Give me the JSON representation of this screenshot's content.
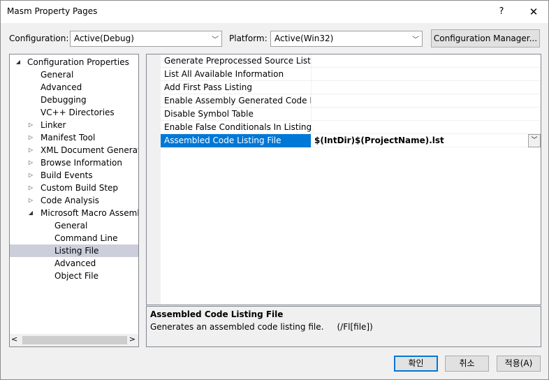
{
  "window": {
    "title": "Masm Property Pages",
    "help": "?",
    "close": "✕"
  },
  "toolbar": {
    "configuration_label": "Configuration:",
    "configuration_value": "Active(Debug)",
    "platform_label": "Platform:",
    "platform_value": "Active(Win32)",
    "config_manager_label": "Configuration Manager..."
  },
  "tree": {
    "items": [
      {
        "label": "Configuration Properties",
        "level": 0,
        "expander": "◢"
      },
      {
        "label": "General",
        "level": 1,
        "expander": ""
      },
      {
        "label": "Advanced",
        "level": 1,
        "expander": ""
      },
      {
        "label": "Debugging",
        "level": 1,
        "expander": ""
      },
      {
        "label": "VC++ Directories",
        "level": 1,
        "expander": ""
      },
      {
        "label": "Linker",
        "level": 1,
        "expander": "▷"
      },
      {
        "label": "Manifest Tool",
        "level": 1,
        "expander": "▷"
      },
      {
        "label": "XML Document Generator",
        "level": 1,
        "expander": "▷"
      },
      {
        "label": "Browse Information",
        "level": 1,
        "expander": "▷"
      },
      {
        "label": "Build Events",
        "level": 1,
        "expander": "▷"
      },
      {
        "label": "Custom Build Step",
        "level": 1,
        "expander": "▷"
      },
      {
        "label": "Code Analysis",
        "level": 1,
        "expander": "▷"
      },
      {
        "label": "Microsoft Macro Assembler",
        "level": 1,
        "expander": "◢"
      },
      {
        "label": "General",
        "level": 2,
        "expander": ""
      },
      {
        "label": "Command Line",
        "level": 2,
        "expander": ""
      },
      {
        "label": "Listing File",
        "level": 2,
        "expander": "",
        "selected": true
      },
      {
        "label": "Advanced",
        "level": 2,
        "expander": ""
      },
      {
        "label": "Object File",
        "level": 2,
        "expander": ""
      }
    ],
    "scroll_left": "<",
    "scroll_right": ">"
  },
  "properties": {
    "rows": [
      {
        "name": "Generate Preprocessed Source Listing",
        "value": ""
      },
      {
        "name": "List All Available Information",
        "value": ""
      },
      {
        "name": "Add First Pass Listing",
        "value": ""
      },
      {
        "name": "Enable Assembly Generated Code Listing",
        "value": ""
      },
      {
        "name": "Disable Symbol Table",
        "value": ""
      },
      {
        "name": "Enable False Conditionals In Listing",
        "value": ""
      },
      {
        "name": "Assembled Code Listing File",
        "value": "$(IntDir)$(ProjectName).lst",
        "selected": true
      }
    ]
  },
  "description": {
    "title": "Assembled Code Listing File",
    "text": "Generates an assembled code listing file.     (/Fl[file])"
  },
  "buttons": {
    "ok": "확인",
    "cancel": "취소",
    "apply": "적용(A)"
  },
  "colors": {
    "selection": "#0078d7",
    "tree_selection": "#cccedb"
  }
}
